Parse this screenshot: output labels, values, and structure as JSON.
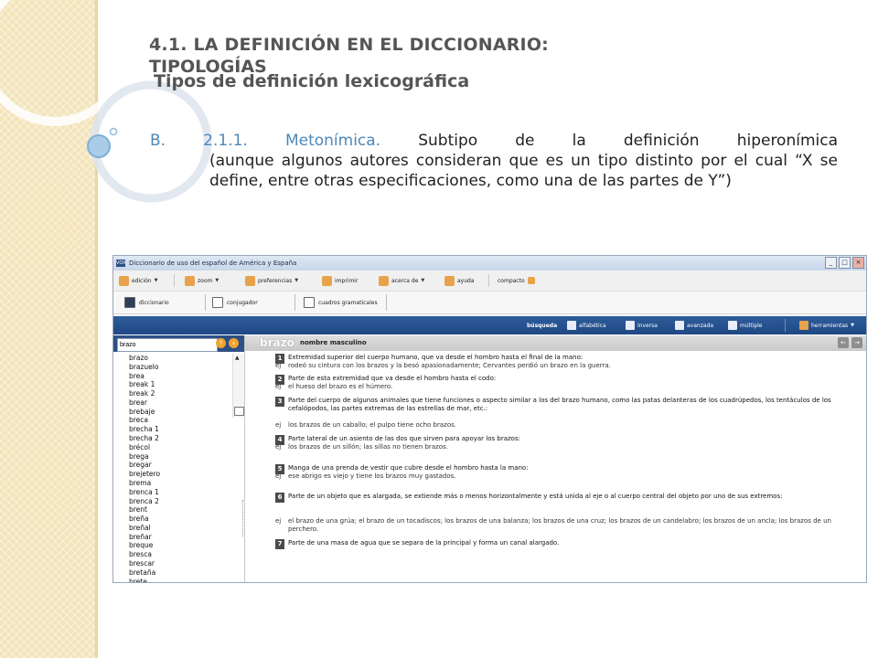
{
  "slide": {
    "title_line1": "4.1. LA DEFINICIÓN EN EL DICCIONARIO:",
    "title_line2": "TIPOLOGÍAS",
    "subtitle": "Tipos de definición lexicográfica",
    "body_label": "B.  2.1.1.  Metonímica.",
    "body_first": "Subtipo de la definición hiperonímica",
    "body_rest": "(aunque algunos autores consideran que es un tipo distinto por el cual “X se define, entre otras especificaciones, como una de las partes de Y”)"
  },
  "window": {
    "app_icon": "VOX",
    "title": "Diccionario de uso del español de América y España",
    "btn_min": "_",
    "btn_max": "□",
    "btn_close": "×"
  },
  "toolbar": {
    "edicion": "edición",
    "zoom": "zoom",
    "preferencias": "preferencias",
    "imprimir": "imprimir",
    "acerca_de": "acerca de",
    "ayuda": "ayuda",
    "compacto": "compacto"
  },
  "tabs": {
    "diccionario": "diccionario",
    "conjugador": "conjugador",
    "cuadros": "cuadros gramaticales"
  },
  "searchbar": {
    "busqueda": "búsqueda",
    "alfabetica": "alfabética",
    "inversa": "inversa",
    "avanzada": "avanzada",
    "multiple": "múltiple",
    "herramientas": "herramientas"
  },
  "wordlist": {
    "input_value": "brazo",
    "words": [
      "brazo",
      "brazuelo",
      "brea",
      "break 1",
      "break 2",
      "brear",
      "brebaje",
      "breca",
      "brecha 1",
      "brecha 2",
      "brécol",
      "brega",
      "bregar",
      "brejetero",
      "brema",
      "brenca 1",
      "brenca 2",
      "brent",
      "breña",
      "breñal",
      "breñar",
      "breque",
      "bresca",
      "brescar",
      "bretaña",
      "brete"
    ]
  },
  "entry": {
    "headword": "brazo",
    "grammar": "nombre masculino",
    "example_label": "ej",
    "senses": [
      {
        "num": "1",
        "def": "Extremidad superior del cuerpo humano, que va desde el hombro hasta el final de la mano:",
        "example": "rodeó su cintura con los brazos y la besó apasionadamente; Cervantes perdió un brazo en la guerra."
      },
      {
        "num": "2",
        "def": "Parte de esta extremidad que va desde el hombro hasta el codo:",
        "example": "el hueso del brazo es el húmero."
      },
      {
        "num": "3",
        "def": "Parte del cuerpo de algunos animales que tiene funciones o aspecto similar a los del brazo humano, como las patas delanteras de los cuadrúpedos, los tentáculos de los cefalópodos, las partes extremas de las estrellas de mar, etc.:",
        "example": "los brazos de un caballo; el pulpo tiene ocho brazos."
      },
      {
        "num": "4",
        "def": "Parte lateral de un asiento de las dos que sirven para apoyar los brazos:",
        "example": "los brazos de un sillón; las sillas no tienen brazos."
      },
      {
        "num": "5",
        "def": "Manga de una prenda de vestir que cubre desde el hombro hasta la mano:",
        "example": "ese abrigo es viejo y tiene los brazos muy gastados."
      },
      {
        "num": "6",
        "def": "Parte de un objeto que es alargada, se extiende más o menos horizontalmente y está unida al eje o al cuerpo central del objeto por uno de sus extremos:",
        "example": "el brazo de una grúa; el brazo de un tocadiscos; los brazos de una balanza; los brazos de una cruz; los brazos de un candelabro; los brazos de un ancla; los brazos de un perchero."
      },
      {
        "num": "7",
        "def": "Parte de una masa de agua que se separa de la principal y forma un canal alargado.",
        "example": ""
      }
    ]
  }
}
